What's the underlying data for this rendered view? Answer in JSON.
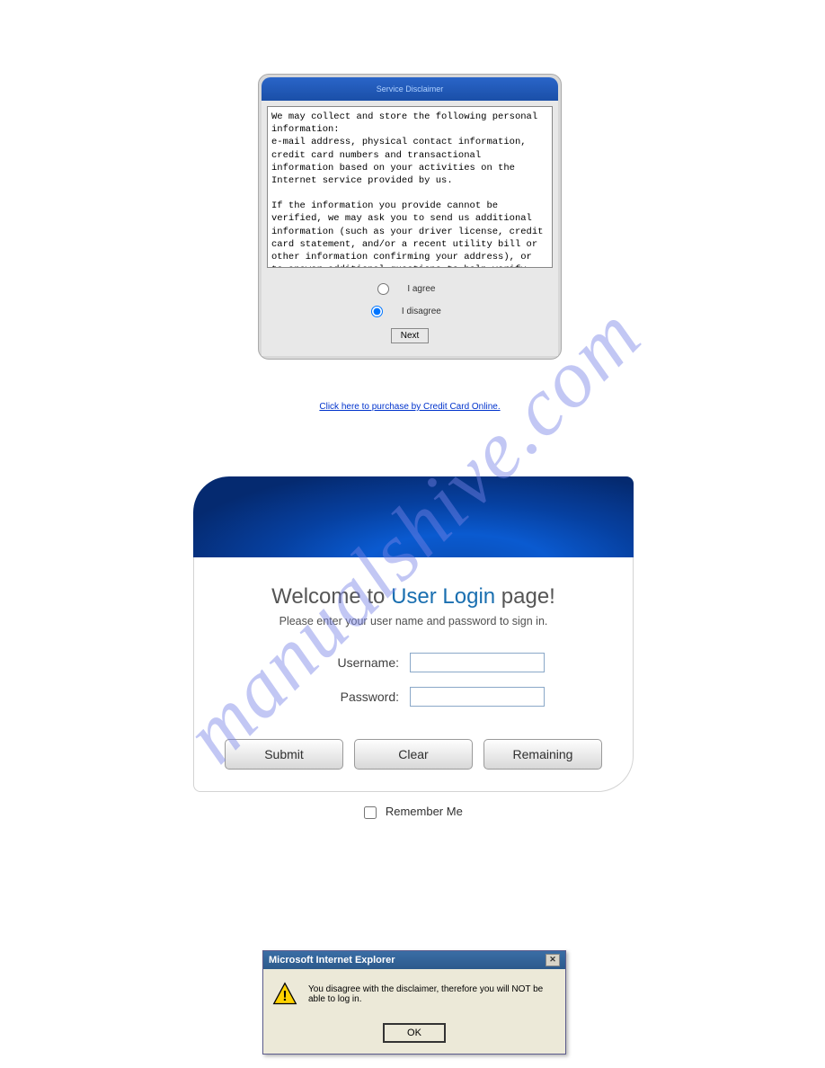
{
  "watermark": "manualshive.com",
  "disclaimer": {
    "title": "Service Disclaimer",
    "text": "We may collect and store the following personal information:\ne-mail address, physical contact information, credit card numbers and transactional information based on your activities on the Internet service provided by us.\n\nIf the information you provide cannot be verified, we may ask you to send us additional information (such as your driver license, credit card statement, and/or a recent utility bill or other information confirming your address), or to answer additional questions to help verify your information.)",
    "agree_label": "I agree",
    "disagree_label": "I disagree",
    "selected": "disagree",
    "next_label": "Next",
    "purchase_link": "Click here to purchase by Credit Card Online."
  },
  "login": {
    "title_prefix": "Welcome to ",
    "title_highlight": "User Login",
    "title_suffix": " page!",
    "subtitle": "Please enter your user name and password  to sign in.",
    "username_label": "Username:",
    "password_label": "Password:",
    "submit_label": "Submit",
    "clear_label": "Clear",
    "remaining_label": "Remaining",
    "remember_label": "Remember Me"
  },
  "dialog": {
    "title": "Microsoft Internet Explorer",
    "message": "You disagree with the disclaimer, therefore you will NOT be able to log in.",
    "ok_label": "OK"
  }
}
